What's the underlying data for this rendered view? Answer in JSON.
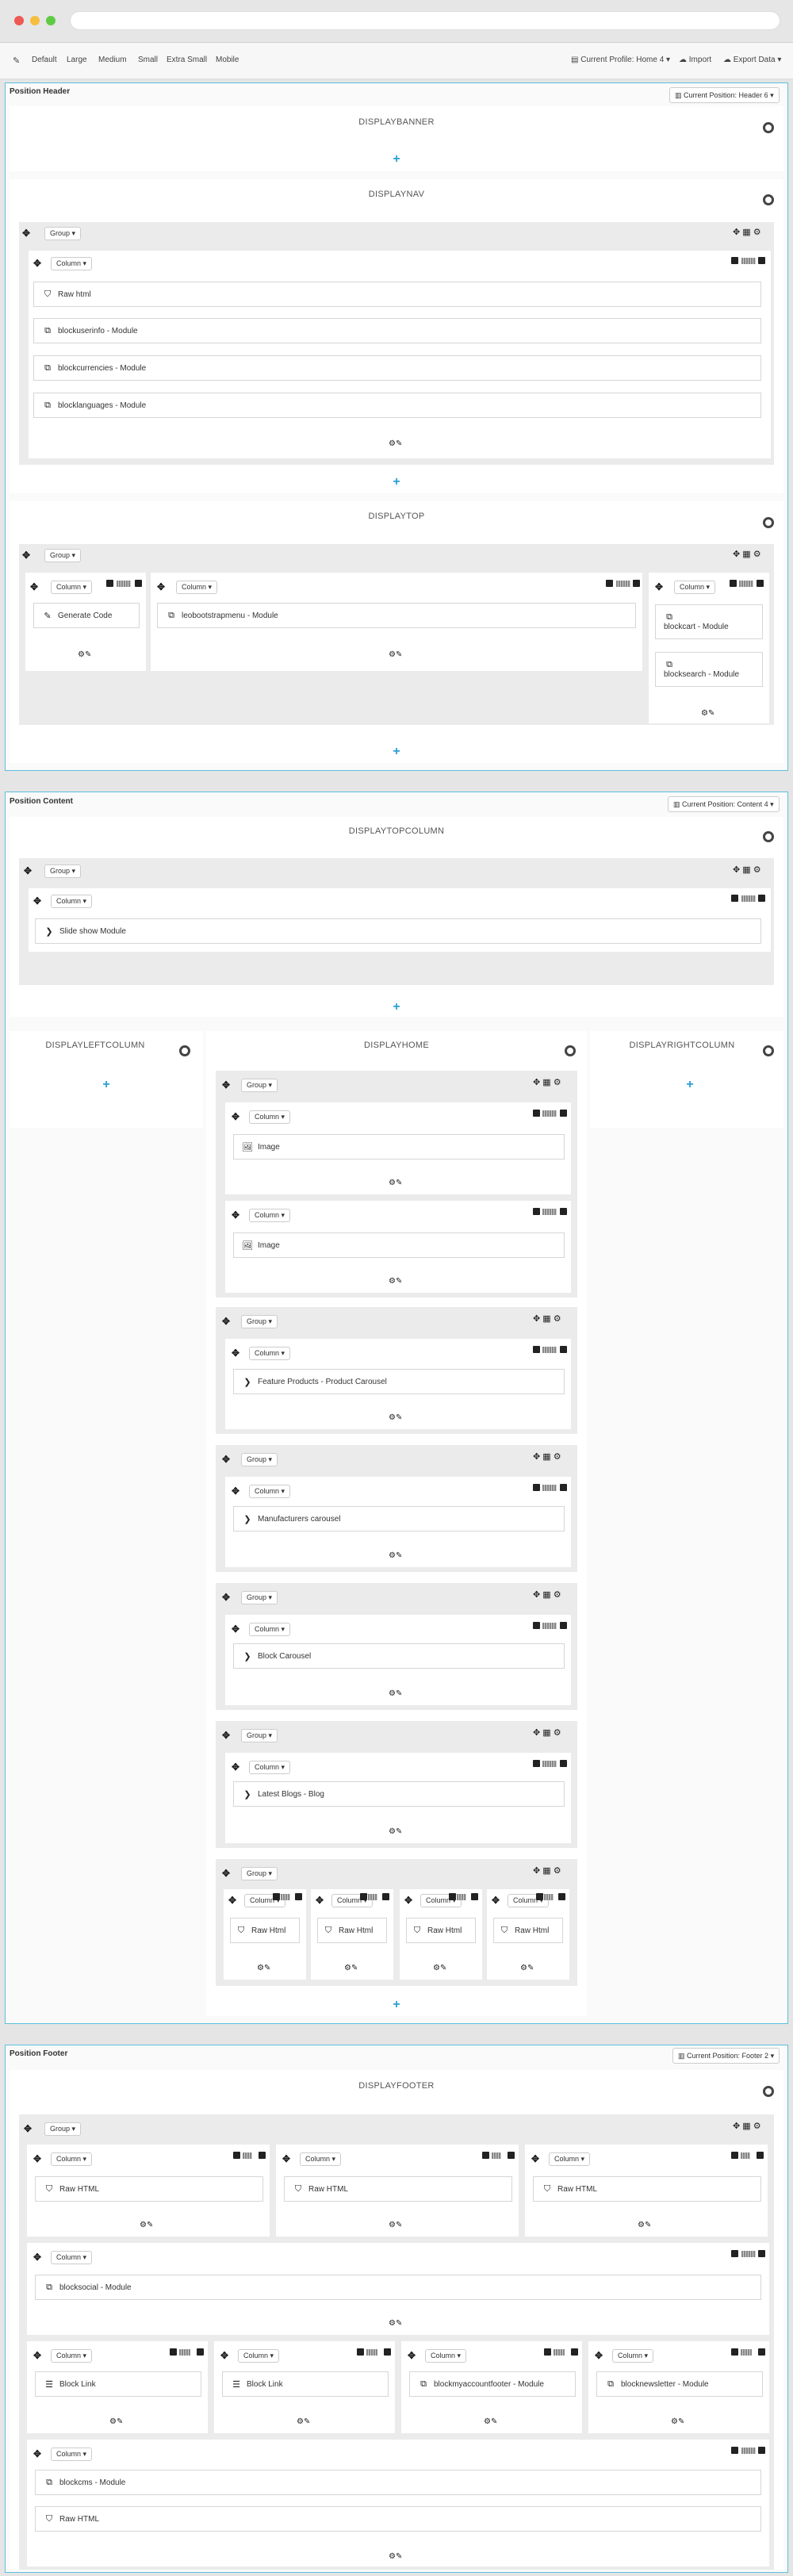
{
  "toolbar": {
    "items": [
      "Default",
      "Large",
      "Medium",
      "Small",
      "Extra Small",
      "Mobile"
    ],
    "profile": "Current Profile: Home 4",
    "import": "Import",
    "export": "Export Data"
  },
  "header": {
    "title": "Position Header",
    "select": "Current Position: Header 6"
  },
  "content": {
    "title": "Position Content",
    "select": "Current Position: Content 4"
  },
  "footer": {
    "title": "Position Footer",
    "select": "Current Position: Footer 2"
  },
  "hooks": {
    "banner": "DISPLAYBANNER",
    "nav": "DISPLAYNAV",
    "top": "DISPLAYTOP",
    "topcolumn": "DISPLAYTOPCOLUMN",
    "left": "DISPLAYLEFTCOLUMN",
    "home": "DISPLAYHOME",
    "right": "DISPLAYRIGHTCOLUMN",
    "footer": "DISPLAYFOOTER"
  },
  "labels": {
    "group": "Group",
    "column": "Column"
  },
  "modules": {
    "raw_html": "Raw html",
    "userinfo": "blockuserinfo - Module",
    "currencies": "blockcurrencies - Module",
    "languages": "blocklanguages - Module",
    "generate": "Generate Code",
    "menu": "leobootstrapmenu - Module",
    "cart": "blockcart - Module",
    "search": "blocksearch - Module",
    "slideshow": "Slide show Module",
    "image": "Image",
    "feature": "Feature Products - Product Carousel",
    "manufacturers": "Manufacturers carousel",
    "blockcarousel": "Block Carousel",
    "blogs": "Latest Blogs - Blog",
    "raw_Html": "Raw Html",
    "raw_HTML": "Raw HTML",
    "social": "blocksocial - Module",
    "blocklink": "Block Link",
    "myaccount": "blockmyaccountfooter - Module",
    "newsletter": "blocknewsletter - Module",
    "cms": "blockcms - Module"
  },
  "colors": {
    "accent": "#2a9fd6",
    "border": "#5bc0de"
  }
}
